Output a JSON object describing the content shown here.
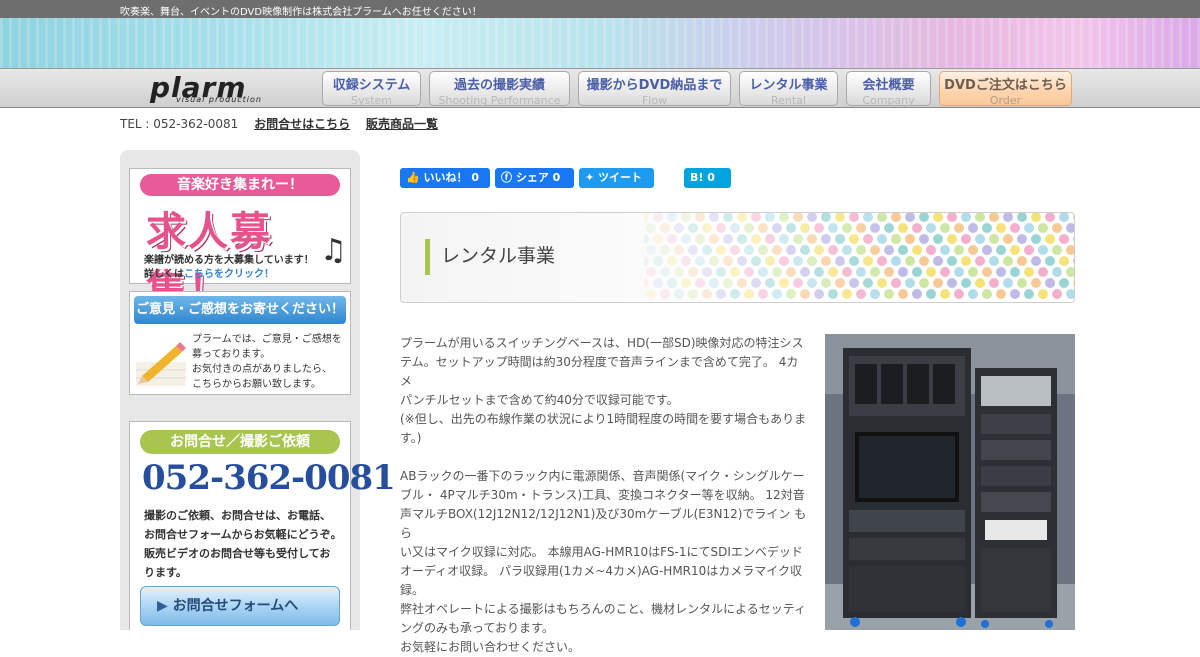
{
  "topbar": {
    "text": "吹奏楽、舞台、イベントのDVD映像制作は株式会社プラームへお任せください！"
  },
  "logo": {
    "main": "plarm",
    "sub": "visual production"
  },
  "nav": [
    {
      "jp": "収録システム",
      "en": "System"
    },
    {
      "jp": "過去の撮影実績",
      "en": "Shooting Performance"
    },
    {
      "jp": "撮影からDVD納品まで",
      "en": "Flow"
    },
    {
      "jp": "レンタル事業",
      "en": "Rental"
    },
    {
      "jp": "会社概要",
      "en": "Company"
    },
    {
      "jp": "DVDご注文はこちら",
      "en": "Order"
    }
  ],
  "contactline": {
    "tel": "TEL : 052-362-0081",
    "inquiry": "お問合せはこちら",
    "products": "販売商品一覧"
  },
  "sidebar": {
    "recruit": {
      "pill": "音楽好き集まれー！",
      "big": "求人募集！",
      "line1": "楽譜が読める方を大募集しています！",
      "line2_prefix": "詳しくは",
      "line2_link": "こちらをクリック！"
    },
    "feedback": {
      "head": "ご意見・ご感想をお寄せください！",
      "lines": [
        "プラームでは、ご意見・ご感想を",
        "募っております。",
        "お気付きの点がありましたら、",
        "こちらからお願い致します。"
      ]
    },
    "contact": {
      "head": "お問合せ／撮影ご依頼",
      "phone": "052-362-0081",
      "lines": [
        "撮影のご依頼、お問合せは、お電話、",
        "お問合せフォームからお気軽にどうぞ。",
        "販売ビデオのお問合せ等も受付してお",
        "ります。"
      ],
      "form_button": "お問合せフォームへ"
    }
  },
  "social": {
    "like": "いいね！ 0",
    "share": "シェア 0",
    "tweet": "ツイート",
    "hatena": "B! 0"
  },
  "page": {
    "title": "レンタル事業"
  },
  "content": {
    "p1": [
      "プラームが用いるスイッチングベースは、HD(一部SD)映像対応の特注シス",
      "テム。セットアップ時間は約30分程度で音声ラインまで含めて完了。 4カメ",
      "パンチルセットまで含めて約40分で収録可能です。",
      "(※但し、出先の布線作業の状況により1時間程度の時間を要す場合もありま",
      "す。)"
    ],
    "p2": [
      "ABラックの一番下のラック内に電源関係、音声関係(マイク・シングルケー",
      "ブル・ 4Pマルチ30m・トランス)工具、変換コネクター等を収納。 12対音",
      "声マルチBOX(12J12N12/12J12N1)及び30mケーブル(E3N12)でライン もら",
      "い又はマイク収録に対応。 本線用AG-HMR10はFS-1にてSDIエンベデッド",
      "オーディオ収録。 パラ収録用(1カメ~4カメ)AG-HMR10はカメラマイク収",
      "録。",
      "弊社オペレートによる撮影はもちろんのこと、機材レンタルによるセッティ",
      "ングのみも承っております。",
      "お気軽にお問い合わせください。"
    ]
  },
  "colors": {
    "accent_green": "#a8c64f",
    "nav_text": "#4a5ea8",
    "facebook": "#1877f2",
    "twitter": "#1d9bf0",
    "hatena": "#00a4de"
  }
}
